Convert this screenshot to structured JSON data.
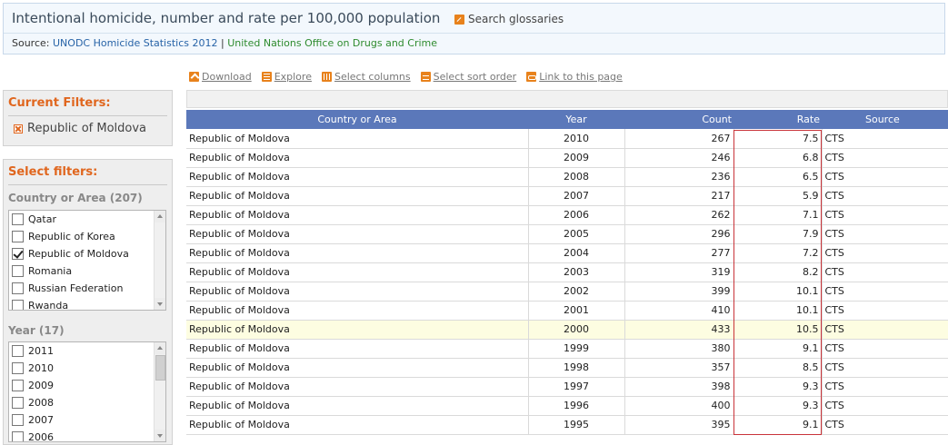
{
  "header": {
    "title": "Intentional homicide, number and rate per 100,000 population",
    "glossary_label": "Search glossaries",
    "source_prefix": "Source:",
    "source_link1": "UNODC Homicide Statistics 2012",
    "source_sep": "|",
    "source_link2": "United Nations Office on Drugs and Crime"
  },
  "toolbar": {
    "download": "Download",
    "explore": "Explore",
    "select_columns": "Select columns",
    "sort_order": "Select sort order",
    "link_page": "Link to this page"
  },
  "current_filters": {
    "title": "Current Filters:",
    "item": "Republic of Moldova"
  },
  "select_filters": {
    "title": "Select filters:",
    "country_heading": "Country or Area (207)",
    "country_options": [
      {
        "label": "Qatar",
        "checked": false
      },
      {
        "label": "Republic of Korea",
        "checked": false
      },
      {
        "label": "Republic of Moldova",
        "checked": true
      },
      {
        "label": "Romania",
        "checked": false
      },
      {
        "label": "Russian Federation",
        "checked": false
      },
      {
        "label": "Rwanda",
        "checked": false
      }
    ],
    "year_heading": "Year (17)",
    "year_options": [
      {
        "label": "2011",
        "checked": false
      },
      {
        "label": "2010",
        "checked": false
      },
      {
        "label": "2009",
        "checked": false
      },
      {
        "label": "2008",
        "checked": false
      },
      {
        "label": "2007",
        "checked": false
      },
      {
        "label": "2006",
        "checked": false
      }
    ]
  },
  "table": {
    "columns": [
      "Country or Area",
      "Year",
      "Count",
      "Rate",
      "Source"
    ],
    "highlight_year": "2000",
    "rows": [
      [
        "Republic of Moldova",
        "2010",
        "267",
        "7.5",
        "CTS"
      ],
      [
        "Republic of Moldova",
        "2009",
        "246",
        "6.8",
        "CTS"
      ],
      [
        "Republic of Moldova",
        "2008",
        "236",
        "6.5",
        "CTS"
      ],
      [
        "Republic of Moldova",
        "2007",
        "217",
        "5.9",
        "CTS"
      ],
      [
        "Republic of Moldova",
        "2006",
        "262",
        "7.1",
        "CTS"
      ],
      [
        "Republic of Moldova",
        "2005",
        "296",
        "7.9",
        "CTS"
      ],
      [
        "Republic of Moldova",
        "2004",
        "277",
        "7.2",
        "CTS"
      ],
      [
        "Republic of Moldova",
        "2003",
        "319",
        "8.2",
        "CTS"
      ],
      [
        "Republic of Moldova",
        "2002",
        "399",
        "10.1",
        "CTS"
      ],
      [
        "Republic of Moldova",
        "2001",
        "410",
        "10.1",
        "CTS"
      ],
      [
        "Republic of Moldova",
        "2000",
        "433",
        "10.5",
        "CTS"
      ],
      [
        "Republic of Moldova",
        "1999",
        "380",
        "9.1",
        "CTS"
      ],
      [
        "Republic of Moldova",
        "1998",
        "357",
        "8.5",
        "CTS"
      ],
      [
        "Republic of Moldova",
        "1997",
        "398",
        "9.3",
        "CTS"
      ],
      [
        "Republic of Moldova",
        "1996",
        "400",
        "9.3",
        "CTS"
      ],
      [
        "Republic of Moldova",
        "1995",
        "395",
        "9.1",
        "CTS"
      ]
    ]
  }
}
